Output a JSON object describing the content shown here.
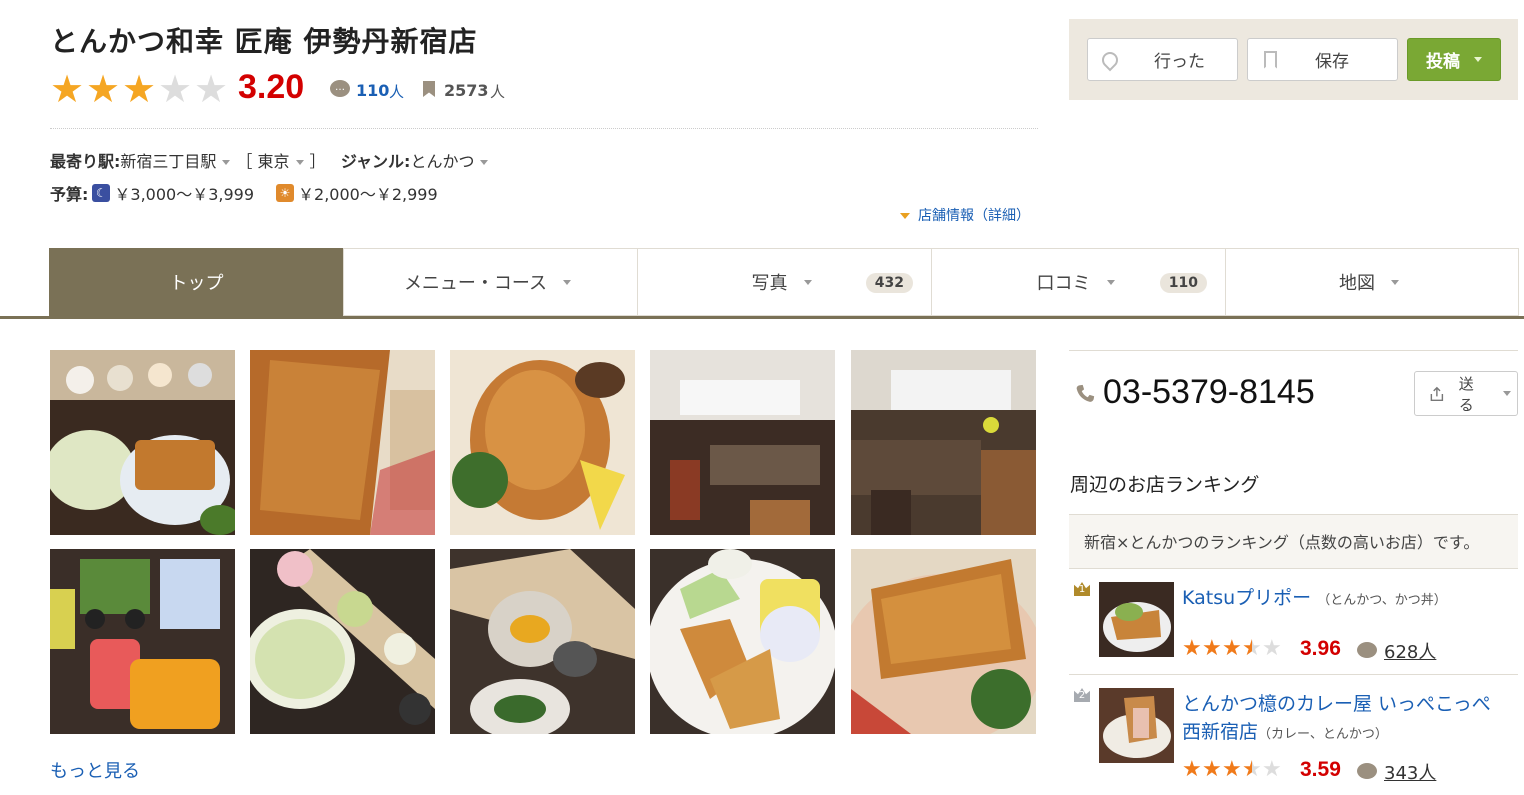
{
  "restaurant": {
    "name": "とんかつ和幸 匠庵 伊勢丹新宿店",
    "rating": "3.20",
    "stars_filled": 3,
    "review_count": "110",
    "review_unit": "人",
    "bookmark_count": "2573",
    "bookmark_unit": "人"
  },
  "info": {
    "station_label": "最寄り駅:",
    "station": "新宿三丁目駅",
    "bracket_open": "［",
    "area": "東京",
    "bracket_close": "］",
    "genre_label": "ジャンル:",
    "genre": "とんかつ",
    "budget_label": "予算:",
    "budget_dinner": "￥3,000～￥3,999",
    "budget_lunch": "￥2,000～￥2,999",
    "detail_link": "店舗情報（詳細）"
  },
  "actions": {
    "went": "行った",
    "save": "保存",
    "post": "投稿"
  },
  "tabs": [
    {
      "label": "トップ",
      "badge": ""
    },
    {
      "label": "メニュー・コース",
      "badge": ""
    },
    {
      "label": "写真",
      "badge": "432"
    },
    {
      "label": "口コミ",
      "badge": "110"
    },
    {
      "label": "地図",
      "badge": ""
    }
  ],
  "photos": [
    "set-meal-photo",
    "katsu-closeup-photo",
    "fried-cutlet-lemon-photo",
    "dining-room-photo",
    "dining-room-2-photo",
    "kids-meal-photo",
    "cabbage-pickles-photo",
    "sauce-bowl-photo",
    "fried-shrimp-plate-photo",
    "katsu-plate-photo"
  ],
  "more_link": "もっと見る",
  "sidebar": {
    "phone": "03-5379-8145",
    "send": "送る",
    "ranking_title": "周辺のお店ランキング",
    "ranking_desc": "新宿×とんかつのランキング（点数の高いお店）です。",
    "items": [
      {
        "rank": "1",
        "name": "Katsuプリポー",
        "genre": "（とんかつ、かつ丼）",
        "score": "3.96",
        "stars": 3.5,
        "reviews": "628人"
      },
      {
        "rank": "2",
        "name": "とんかつ檍のカレー屋 いっぺこっぺ 西新宿店",
        "genre": "（カレー、とんかつ）",
        "score": "3.59",
        "stars": 3.5,
        "reviews": "343人"
      }
    ]
  },
  "colors": {
    "accent": "#7a7156",
    "rating": "#d30000",
    "link": "#1a5fb4",
    "post": "#7aa834",
    "star": "#f5a623"
  }
}
